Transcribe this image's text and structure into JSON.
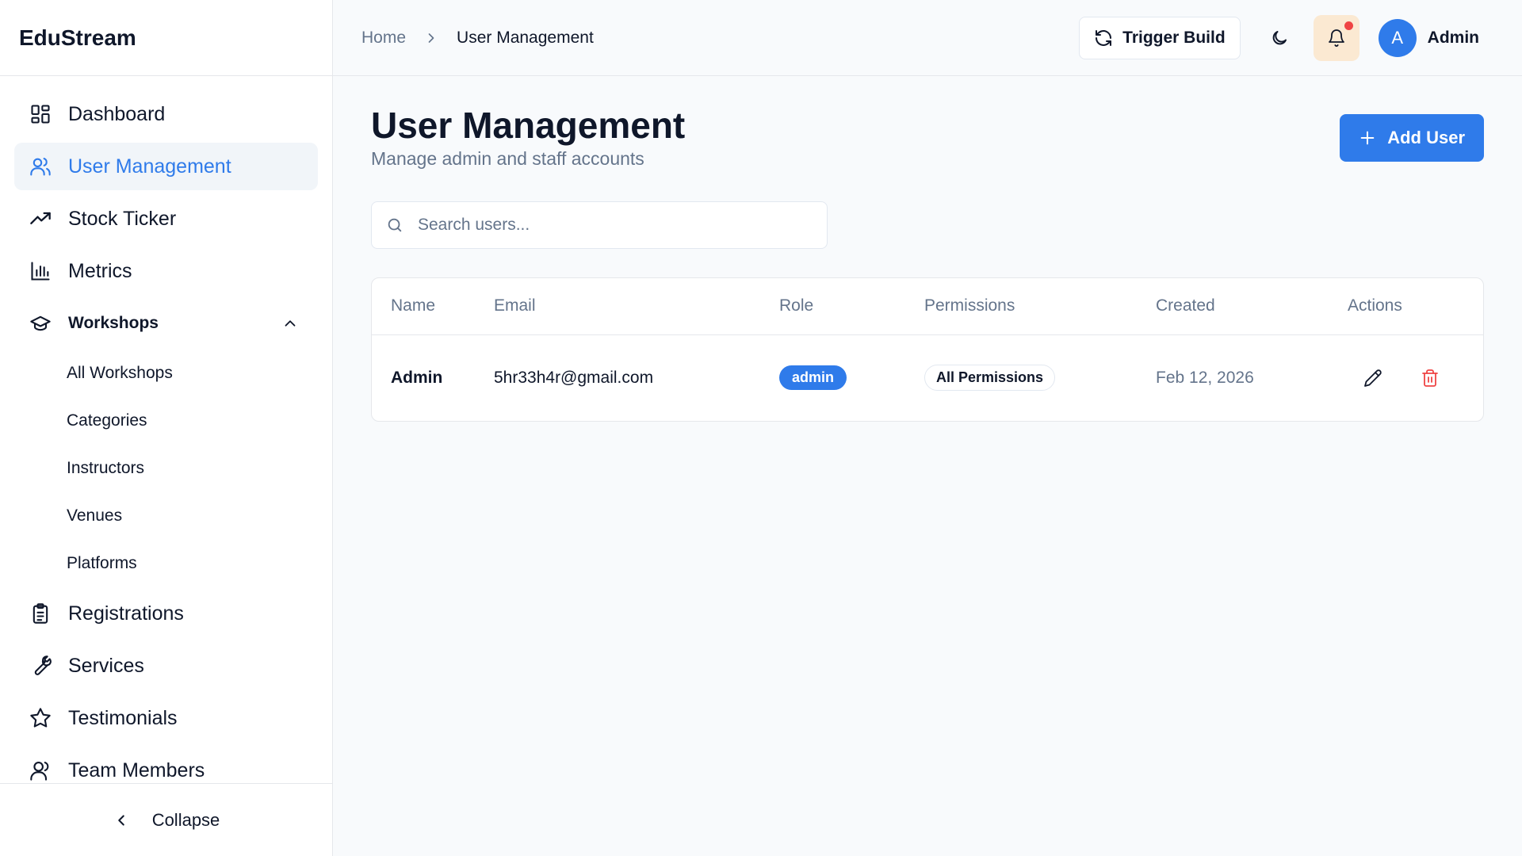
{
  "app": {
    "brand": "EduStream"
  },
  "sidebar": {
    "items": [
      {
        "label": "Dashboard",
        "icon": "dashboard-icon"
      },
      {
        "label": "User Management",
        "icon": "users-icon"
      },
      {
        "label": "Stock Ticker",
        "icon": "trending-up-icon"
      },
      {
        "label": "Metrics",
        "icon": "bar-chart-icon"
      }
    ],
    "workshops": {
      "label": "Workshops",
      "icon": "graduation-cap-icon",
      "sub": [
        "All Workshops",
        "Categories",
        "Instructors",
        "Venues",
        "Platforms"
      ]
    },
    "items2": [
      {
        "label": "Registrations",
        "icon": "clipboard-icon"
      },
      {
        "label": "Services",
        "icon": "wrench-icon"
      },
      {
        "label": "Testimonials",
        "icon": "star-icon"
      },
      {
        "label": "Team Members",
        "icon": "user-icon"
      }
    ],
    "collapse_label": "Collapse"
  },
  "header": {
    "breadcrumb": {
      "home": "Home",
      "current": "User Management"
    },
    "trigger_build": "Trigger Build",
    "avatar_letter": "A",
    "user_name": "Admin"
  },
  "page": {
    "title": "User Management",
    "subtitle": "Manage admin and staff accounts",
    "add_button": "Add User",
    "search_placeholder": "Search users..."
  },
  "table": {
    "columns": [
      "Name",
      "Email",
      "Role",
      "Permissions",
      "Created",
      "Actions"
    ],
    "rows": [
      {
        "name": "Admin",
        "email": "5hr33h4r@gmail.com",
        "role": "admin",
        "permissions": "All Permissions",
        "created": "Feb 12, 2026"
      }
    ]
  },
  "colors": {
    "accent": "#2f7bea",
    "danger": "#ef4444",
    "muted": "#64748b",
    "notification_bg": "#fbe9d2"
  }
}
